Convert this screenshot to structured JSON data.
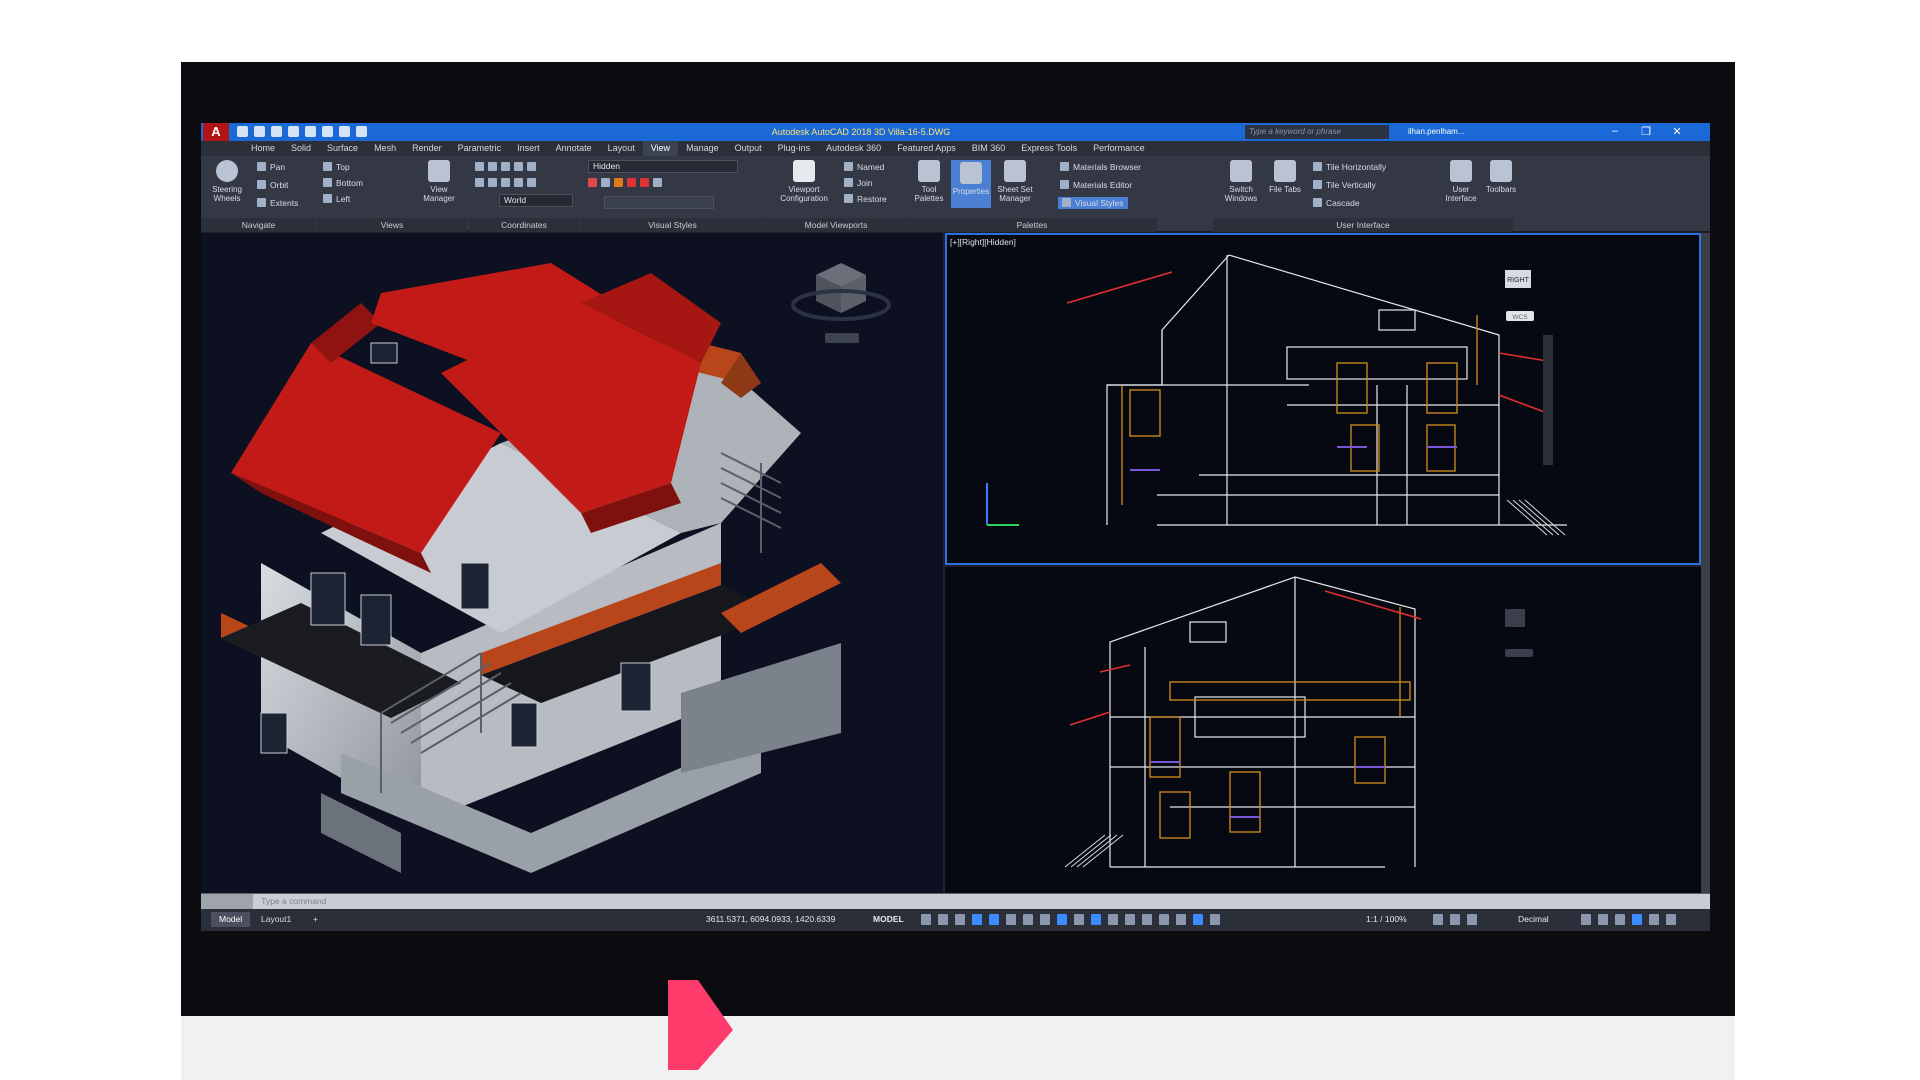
{
  "window": {
    "title": "Autodesk AutoCAD 2018   3D Villa-16-5.DWG",
    "search_placeholder": "Type a keyword or phrase",
    "user": "ilhan.penlham...",
    "logo": "A"
  },
  "menu_tabs": [
    "Home",
    "Solid",
    "Surface",
    "Mesh",
    "Render",
    "Parametric",
    "Insert",
    "Annotate",
    "Layout",
    "View",
    "Manage",
    "Output",
    "Plug-ins",
    "Autodesk 360",
    "Featured Apps",
    "BIM 360",
    "Express Tools",
    "Performance"
  ],
  "active_tab": "View",
  "ribbon": {
    "navigate": {
      "label": "Navigate",
      "steering": "Steering Wheels",
      "pan": "Pan",
      "orbit": "Orbit",
      "extents": "Extents"
    },
    "views": {
      "label": "Views",
      "top": "Top",
      "bottom": "Bottom",
      "left": "Left",
      "view_manager": "View Manager"
    },
    "coordinates": {
      "label": "Coordinates",
      "world": "World"
    },
    "visual_styles": {
      "label": "Visual Styles",
      "current": "Hidden"
    },
    "model_viewports": {
      "label": "Model Viewports",
      "viewport_config": "Viewport Configuration",
      "named": "Named",
      "join": "Join",
      "restore": "Restore"
    },
    "palettes": {
      "label": "Palettes",
      "tool_palettes": "Tool Palettes",
      "properties": "Properties",
      "sheet_set": "Sheet Set Manager",
      "materials_browser": "Materials Browser",
      "materials_editor": "Materials Editor",
      "visual_styles": "Visual Styles"
    },
    "user_interface": {
      "label": "User Interface",
      "switch_windows": "Switch Windows",
      "file_tabs": "File Tabs",
      "tile_h": "Tile Horizontally",
      "tile_v": "Tile Vertically",
      "cascade": "Cascade",
      "user_interface": "User Interface",
      "toolbars": "Toolbars"
    }
  },
  "viewports": {
    "right_top_label": "[+][Right][Hidden]",
    "viewcube_face": "RIGHT",
    "wcs": "WCS"
  },
  "command_line": {
    "placeholder": "Type a command"
  },
  "status": {
    "layout_tabs": [
      "Model",
      "Layout1",
      "+"
    ],
    "active_layout": "Model",
    "coordinates": "3611.5371, 6094.0933, 1420.6339",
    "mode": "MODEL",
    "scale": "1:1 / 100%",
    "units": "Decimal"
  },
  "colors": {
    "title_blue": "#1a69d6",
    "roof_red": "#c21a16",
    "viewport_border": "#2f6fe0",
    "balcony_orange": "#b8461a"
  }
}
